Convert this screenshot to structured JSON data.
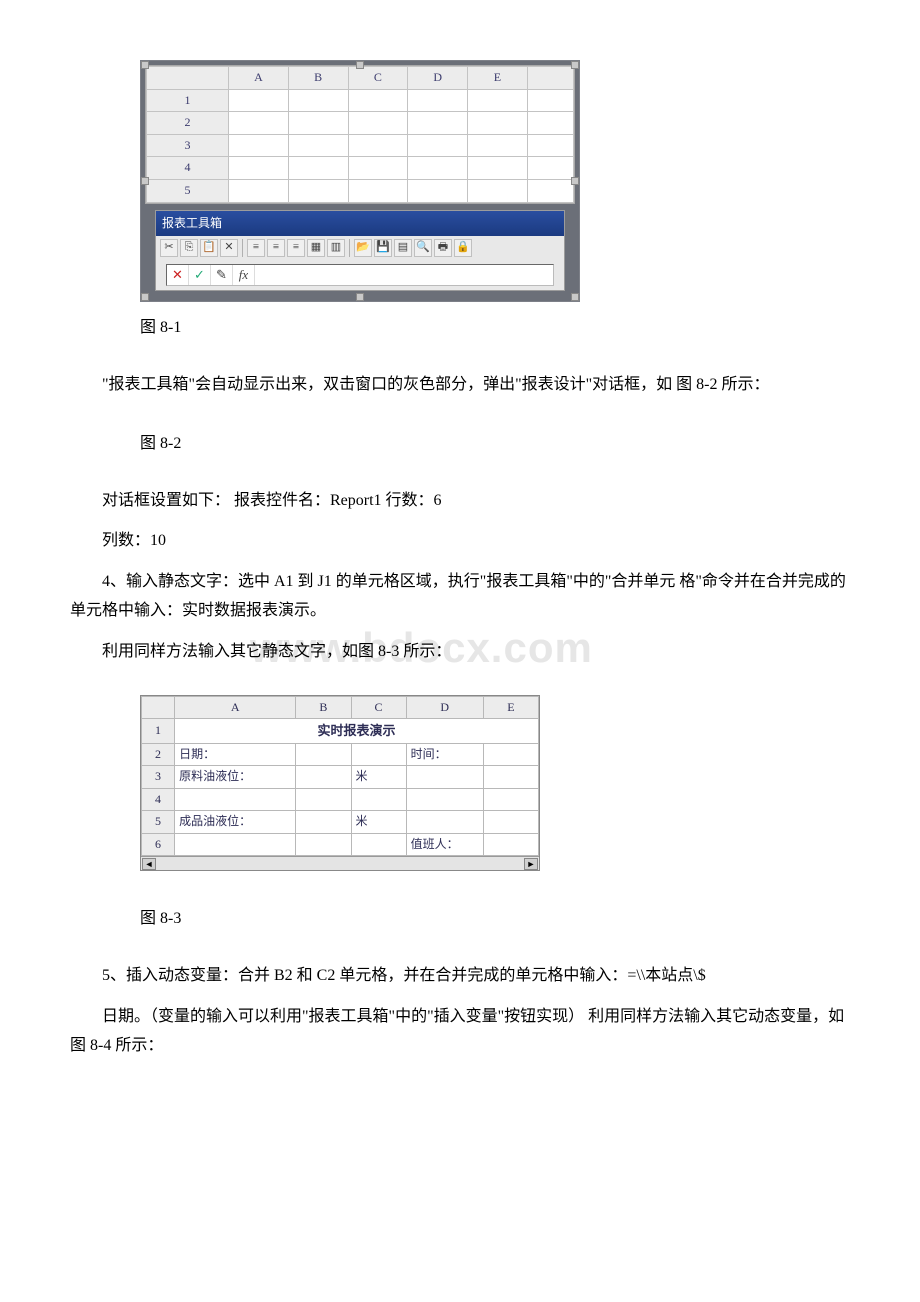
{
  "figure81": {
    "caption": "图 8-1",
    "col_headers": [
      "A",
      "B",
      "C",
      "D",
      "E"
    ],
    "row_headers": [
      "1",
      "2",
      "3",
      "4",
      "5"
    ],
    "toolbox_title": "报表工具箱",
    "toolbar_row1": {
      "cut": "✂",
      "copy": "⎘",
      "paste": "📋",
      "delete": "✕",
      "align_left": "≡",
      "align_center": "≡",
      "align_right": "≡",
      "merge1": "▦",
      "merge2": "▥",
      "open": "📂",
      "save": "💾",
      "table": "▤",
      "preview": "🔍",
      "print": "🖶",
      "lock": "🔒"
    },
    "formula_bar": {
      "cancel": "✕",
      "confirm": "✓",
      "clip": "✎",
      "fx": "fx"
    }
  },
  "paragraphs": {
    "p1": "\"报表工具箱\"会自动显示出来，双击窗口的灰色部分，弹出\"报表设计\"对话框，如 图 8-2 所示：",
    "fig82_caption": "图 8-2",
    "p2": "对话框设置如下： 报表控件名：Report1 行数：6",
    "p3": "列数：10",
    "p4": "4、输入静态文字：选中 A1 到 J1 的单元格区域，执行\"报表工具箱\"中的\"合并单元 格\"命令并在合并完成的单元格中输入：实时数据报表演示。",
    "p5": "利用同样方法输入其它静态文字，如图 8-3 所示：",
    "fig83_caption": "图 8-3",
    "p6": "5、插入动态变量：合并 B2 和 C2 单元格，并在合并完成的单元格中输入：=\\\\本站点\\$",
    "p7": "日期。（变量的输入可以利用\"报表工具箱\"中的\"插入变量\"按钮实现） 利用同样方法输入其它动态变量，如图 8-4 所示："
  },
  "watermark": "www.bdocx.com",
  "chart_data": {
    "type": "table",
    "title": "实时报表演示",
    "col_headers": [
      "A",
      "B",
      "C",
      "D",
      "E"
    ],
    "row_headers": [
      "1",
      "2",
      "3",
      "4",
      "5",
      "6"
    ],
    "cells": {
      "row1_merged": "实时报表演示",
      "A2": "日期：",
      "D2": "时间：",
      "A3": "原料油液位：",
      "C3": "米",
      "A5": "成品油液位：",
      "C5": "米",
      "D6": "值班人："
    }
  }
}
